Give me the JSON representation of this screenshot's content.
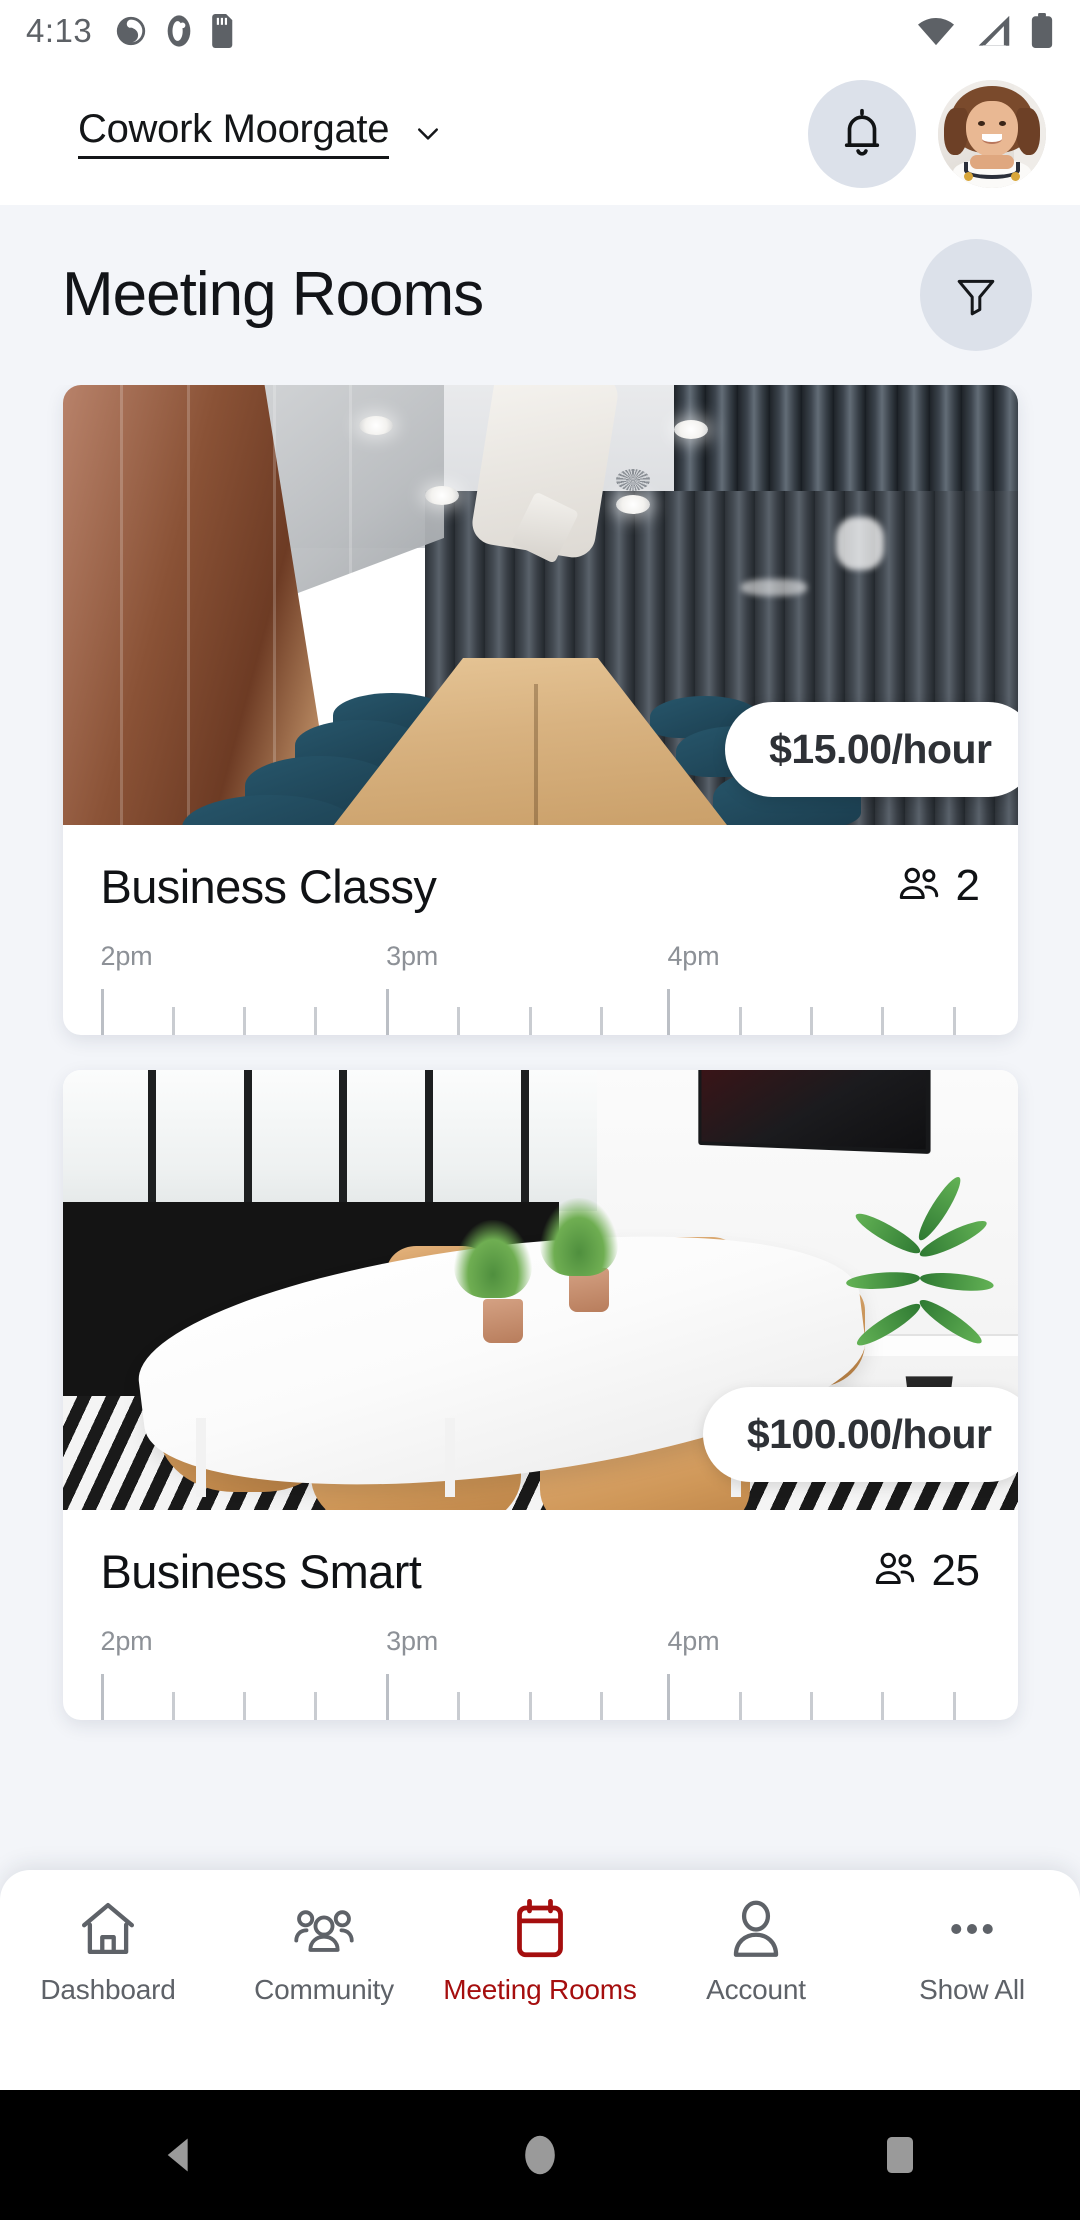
{
  "status_bar": {
    "time": "4:13",
    "left_icons": [
      "app-icon-swirl",
      "app-icon-oval",
      "sd-card-icon"
    ],
    "right_icons": [
      "wifi-icon",
      "cellular-signal-icon",
      "battery-icon"
    ]
  },
  "header": {
    "location_name": "Cowork Moorgate",
    "location_chevron": "chevron-down-icon",
    "bell_icon": "notification-bell-icon",
    "avatar": "user-avatar"
  },
  "page": {
    "title": "Meeting Rooms",
    "filter_icon": "filter-funnel-icon"
  },
  "rooms": [
    {
      "name": "Business Classy",
      "price": "$15.00/hour",
      "capacity": "2",
      "capacity_icon": "people-group-icon",
      "timeline": {
        "labels": [
          "2pm",
          "3pm",
          "4pm"
        ],
        "label_positions_pct": [
          0,
          32.5,
          64.5
        ],
        "tick_positions_pct": [
          0,
          8.1,
          16.2,
          24.3,
          32.5,
          40.6,
          48.7,
          56.8,
          64.5,
          72.6,
          80.7,
          88.8,
          97
        ]
      }
    },
    {
      "name": "Business Smart",
      "price": "$100.00/hour",
      "capacity": "25",
      "capacity_icon": "people-group-icon",
      "timeline": {
        "labels": [
          "2pm",
          "3pm",
          "4pm"
        ],
        "label_positions_pct": [
          0,
          32.5,
          64.5
        ],
        "tick_positions_pct": [
          0,
          8.1,
          16.2,
          24.3,
          32.5,
          40.6,
          48.7,
          56.8,
          64.5,
          72.6,
          80.7,
          88.8,
          97
        ]
      }
    }
  ],
  "bottom_nav": {
    "active_color": "#a50e0e",
    "inactive_color": "#5e6268",
    "items": [
      {
        "label": "Dashboard",
        "icon": "home-icon",
        "active": false
      },
      {
        "label": "Community",
        "icon": "people-group-icon",
        "active": false
      },
      {
        "label": "Meeting Rooms",
        "icon": "calendar-icon",
        "active": true
      },
      {
        "label": "Account",
        "icon": "person-icon",
        "active": false
      },
      {
        "label": "Show All",
        "icon": "ellipsis-icon",
        "active": false
      }
    ]
  },
  "android_nav": {
    "back": "back-triangle-icon",
    "home": "home-circle-icon",
    "recents": "recents-square-icon"
  },
  "colors": {
    "accent_red": "#a50e0e",
    "page_background": "#f3f5f9",
    "header_background": "#ffffff",
    "icon_circle": "#dce1ea",
    "title_text": "#121418",
    "muted_text": "#8d9197"
  }
}
